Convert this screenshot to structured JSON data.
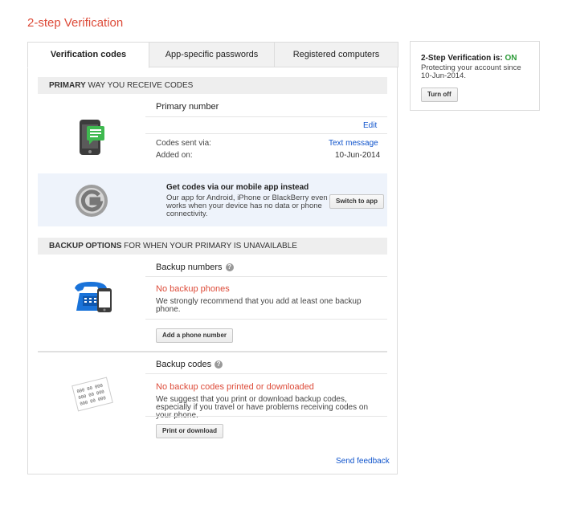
{
  "page": {
    "title": "2-step Verification"
  },
  "tabs": [
    {
      "label": "Verification codes",
      "active": true
    },
    {
      "label": "App-specific passwords",
      "active": false
    },
    {
      "label": "Registered computers",
      "active": false
    }
  ],
  "primary": {
    "header_bold": "PRIMARY",
    "header_rest": " WAY YOU RECEIVE CODES",
    "title": "Primary number",
    "edit_label": "Edit",
    "codes_sent_label": "Codes sent via:",
    "codes_sent_value": "Text message",
    "added_label": "Added on:",
    "added_value": "10-Jun-2014"
  },
  "promo": {
    "title": "Get codes via our mobile app instead",
    "text": "Our app for Android, iPhone or BlackBerry even works when your device has no data or phone connectivity.",
    "button": "Switch to app"
  },
  "backup": {
    "header_bold": "BACKUP OPTIONS",
    "header_rest": " FOR WHEN YOUR PRIMARY IS UNAVAILABLE",
    "numbers_title": "Backup numbers",
    "numbers_warning": "No backup phones",
    "numbers_text": "We strongly recommend that you add at least one backup phone.",
    "numbers_button": "Add a phone number",
    "codes_title": "Backup codes",
    "codes_warning": "No backup codes printed or downloaded",
    "codes_text": "We suggest that you print or download backup codes, especially if you travel or have problems receiving codes on your phone.",
    "codes_button": "Print or download",
    "code_sample": "000 00 000"
  },
  "feedback": {
    "label": "Send feedback"
  },
  "status": {
    "label": "2-Step Verification is:",
    "state": "ON",
    "since": "Protecting your account since 10-Jun-2014.",
    "button": "Turn off"
  },
  "colors": {
    "accent_red": "#dd4b39",
    "link_blue": "#1155cc",
    "status_green": "#2a9a36",
    "promo_bg": "#eef3fb"
  },
  "icons": [
    "phone-sms-icon",
    "authenticator-icon",
    "desk-phone-icon",
    "backup-codes-icon",
    "help-icon"
  ]
}
